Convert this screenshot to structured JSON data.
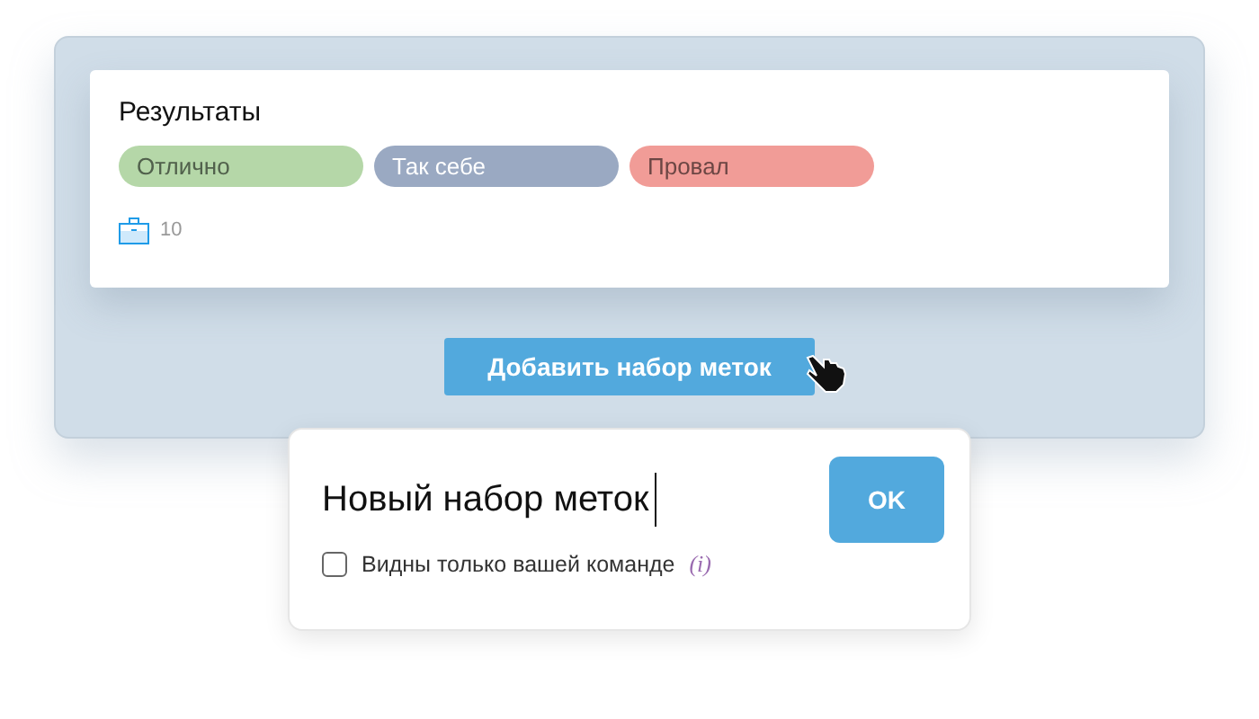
{
  "card": {
    "title": "Результаты",
    "tags": [
      {
        "label": "Отлично",
        "color": "#b5d7a8"
      },
      {
        "label": "Так себе",
        "color": "#9aa9c2"
      },
      {
        "label": "Провал",
        "color": "#f19c97"
      }
    ],
    "count": "10"
  },
  "add_button": "Добавить набор меток",
  "popup": {
    "value": "Новый набор меток",
    "ok": "OK",
    "checkbox": {
      "label": "Видны только вашей команде",
      "checked": false
    },
    "info": "(i)"
  }
}
